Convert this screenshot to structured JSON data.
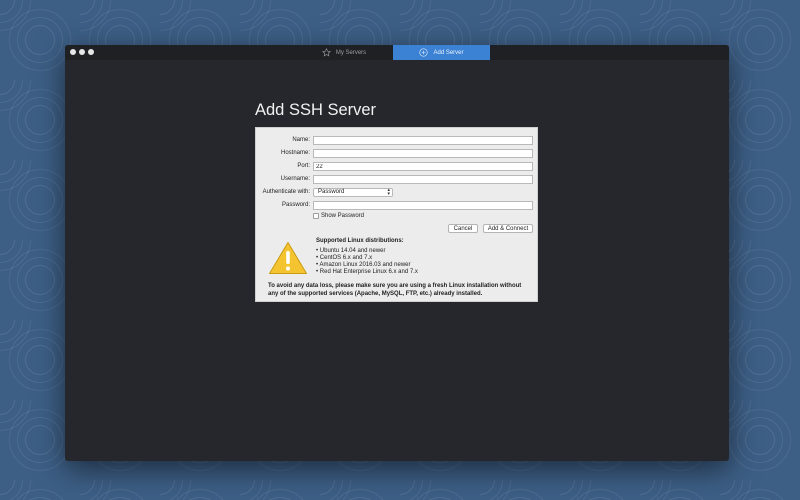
{
  "tabs": [
    {
      "label": "My Servers",
      "icon": "star-icon",
      "active": false
    },
    {
      "label": "Add Server",
      "icon": "plus-circle-icon",
      "active": true
    }
  ],
  "page": {
    "title": "Add SSH Server"
  },
  "form": {
    "name": {
      "label": "Name:",
      "value": ""
    },
    "hostname": {
      "label": "Hostname:",
      "value": ""
    },
    "port": {
      "label": "Port:",
      "value": "22"
    },
    "username": {
      "label": "Username:",
      "value": ""
    },
    "auth": {
      "label": "Authenticate with:",
      "value": "Password"
    },
    "password": {
      "label": "Password:",
      "value": ""
    },
    "show_password": {
      "label": "Show Password",
      "checked": false
    },
    "cancel_label": "Cancel",
    "connect_label": "Add & Connect"
  },
  "info": {
    "heading": "Supported Linux distributions:",
    "distros": [
      "Ubuntu 14.04 and newer",
      "CentOS 6.x and 7.x",
      "Amazon Linux 2016.03 and newer",
      "Red Hat Enterprise Linux 6.x and 7.x"
    ],
    "note": "To avoid any data loss, please make sure you are using a fresh Linux installation without any of the supported services (Apache, MySQL, FTP, etc.) already installed."
  },
  "colors": {
    "accent": "#3b82d4",
    "window_bg": "#26272c",
    "panel_bg": "#ececec",
    "warning": "#f4c430"
  }
}
